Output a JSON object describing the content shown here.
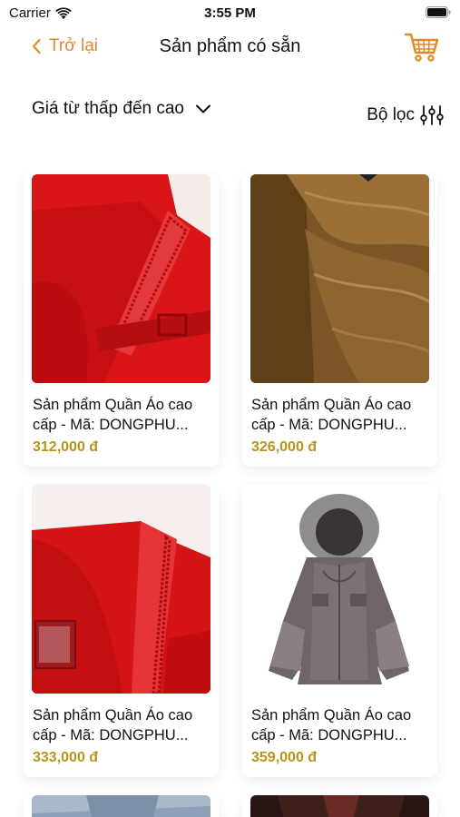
{
  "status_bar": {
    "carrier": "Carrier",
    "time": "3:55 PM"
  },
  "nav": {
    "back_label": "Trở lại",
    "title": "Sản phẩm có sẵn"
  },
  "sort": {
    "label": "Giá từ thấp đến cao"
  },
  "filter": {
    "label": "Bộ lọc"
  },
  "colors": {
    "accent": "#e08a2e",
    "price": "#b8941c"
  },
  "products": [
    {
      "name": "Sản phẩm Quần Áo cao cấp - Mã: DONGPHU...",
      "price": "312,000 đ",
      "image": "red-jacket-collar"
    },
    {
      "name": "Sản phẩm Quần Áo cao cấp - Mã: DONGPHU...",
      "price": "326,000 đ",
      "image": "brown-puffer"
    },
    {
      "name": "Sản phẩm Quần Áo cao cấp - Mã: DONGPHU...",
      "price": "333,000 đ",
      "image": "red-jacket-hood"
    },
    {
      "name": "Sản phẩm Quần Áo cao cấp - Mã: DONGPHU...",
      "price": "359,000 đ",
      "image": "gray-parka"
    }
  ]
}
